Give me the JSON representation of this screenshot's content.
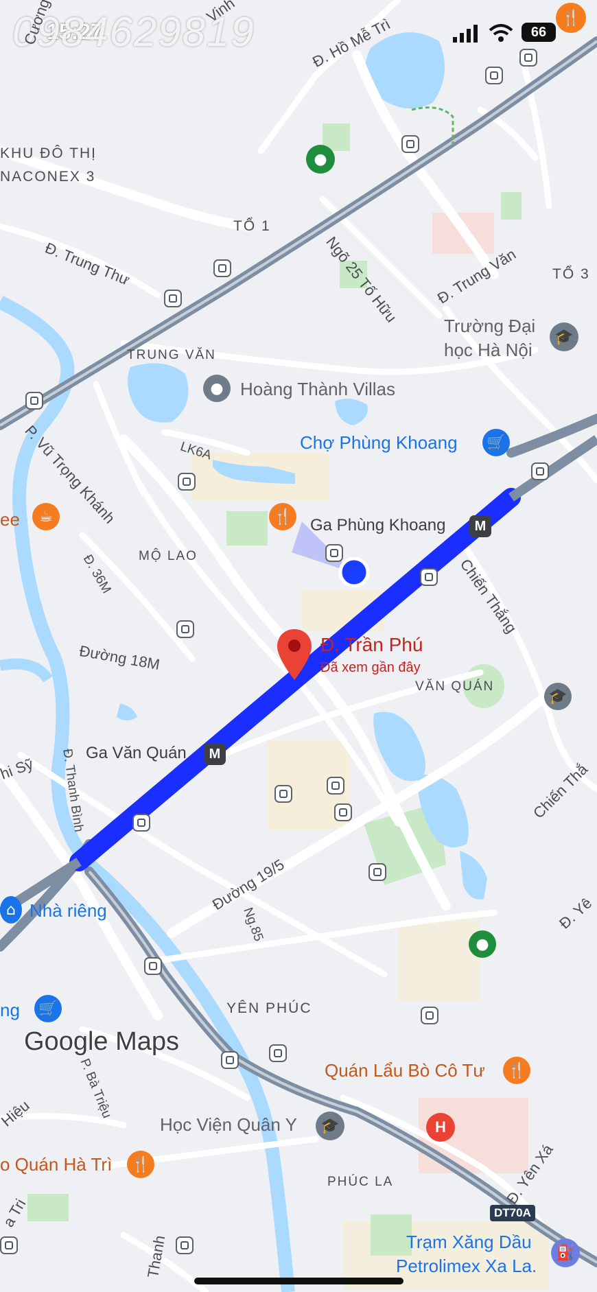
{
  "status_bar": {
    "time": "15:27",
    "battery": "66",
    "watermark": "0984629819"
  },
  "selected_place": {
    "title": "Đ. Trần Phú",
    "subtitle": "Đã xem gần đây"
  },
  "streets": {
    "cuong": "Cương",
    "vinh": "Vinh",
    "ho_me_tri": "Đ. Hồ Mễ Trì",
    "ngo25": "Ngõ 25 Tố Hữu",
    "trung_thu": "Đ. Trung Thư",
    "trung_van": "Đ. Trung Văn",
    "vu_trong_khanh": "P. Vũ Trọng Khánh",
    "lk6a": "LK6A",
    "d36m": "Đ. 36M",
    "duong18m": "Đường 18M",
    "chien_thang_1": "Chiến Thắng",
    "chien_thang_2": "Chiến Thắ",
    "thanh_binh": "Đ. Thanh Bình",
    "thi_sy": "hi Sỹ",
    "duong19_5": "Đường 19/5",
    "ng85": "Ng.85",
    "d_yen": "Đ. Yê",
    "ba_trieu": "P. Bà Triệu",
    "hieu": "Hiệu",
    "yen_xa": "Đ. Yên Xá",
    "tri": "a Tri",
    "thanh": "Thanh",
    "dt70a": "DT70A"
  },
  "areas": {
    "khu_do_thi": "KHU ĐÔ THỊ",
    "naconex": "NACONEX 3",
    "to1": "TỔ 1",
    "to3": "TỔ 3",
    "trung_van": "TRUNG VĂN",
    "mo_lao": "MỘ LAO",
    "van_quan": "VĂN QUÁN",
    "yen_phuc": "YÊN PHÚC",
    "phuc_la": "PHÚC LA"
  },
  "pois": {
    "truong_dai_hoc_1": "Trường Đại",
    "truong_dai_hoc_2": "học Hà Nội",
    "hoang_thanh": "Hoàng Thành Villas",
    "cho_phung_khoang": "Chợ Phùng Khoang",
    "ga_phung_khoang": "Ga Phùng Khoang",
    "ga_van_quan": "Ga Văn Quán",
    "nha_rieng": "Nhà riêng",
    "ng_left": "ng",
    "ee_left": "ee",
    "quan_lau": "Quán Lẩu Bò Cô Tư",
    "hoc_vien": "Học Viện Quân Y",
    "o_quan_ha_tri": "o Quán Hà Trì",
    "tram_xang_1": "Trạm Xăng Dầu",
    "tram_xang_2": "Petrolimex Xa La."
  },
  "branding": {
    "google_maps": "Google Maps"
  },
  "icons": {
    "metro_glyph": "M",
    "hospital_glyph": "H"
  },
  "colors": {
    "route": "#1a2eff",
    "water": "#aadaff",
    "park": "#c8e8c6",
    "road": "#ffffff",
    "highway": "#7d8ea3",
    "pin": "#ea4335",
    "food": "#f57c1f",
    "shop": "#1a73e8",
    "green_poi": "#1e8e3e",
    "school": "#6f7b88"
  }
}
